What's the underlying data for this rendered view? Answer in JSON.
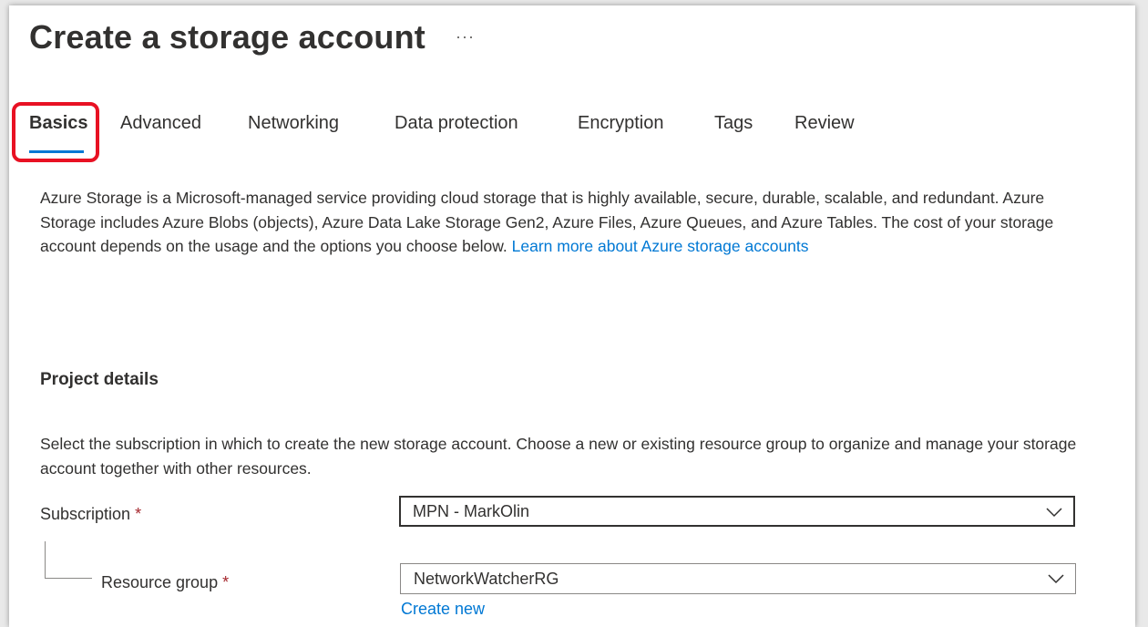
{
  "page": {
    "title": "Create a storage account",
    "more_label": "···"
  },
  "tabs": [
    {
      "label": "Basics",
      "active": true
    },
    {
      "label": "Advanced",
      "active": false
    },
    {
      "label": "Networking",
      "active": false
    },
    {
      "label": "Data protection",
      "active": false
    },
    {
      "label": "Encryption",
      "active": false
    },
    {
      "label": "Tags",
      "active": false
    },
    {
      "label": "Review",
      "active": false
    }
  ],
  "intro": {
    "text": "Azure Storage is a Microsoft-managed service providing cloud storage that is highly available, secure, durable, scalable, and redundant. Azure Storage includes Azure Blobs (objects), Azure Data Lake Storage Gen2, Azure Files, Azure Queues, and Azure Tables. The cost of your storage account depends on the usage and the options you choose below. ",
    "link": "Learn more about Azure storage accounts"
  },
  "project_details": {
    "title": "Project details",
    "description": "Select the subscription in which to create the new storage account. Choose a new or existing resource group to organize and manage your storage account together with other resources.",
    "subscription": {
      "label": "Subscription",
      "required_mark": "*",
      "value": "MPN - MarkOlin"
    },
    "resource_group": {
      "label": "Resource group",
      "required_mark": "*",
      "value": "NetworkWatcherRG",
      "create_new": "Create new"
    }
  },
  "colors": {
    "accent": "#0078d4",
    "highlight": "#e81123",
    "required": "#a4262c"
  },
  "icons": {
    "more": "more-horizontal-icon",
    "dropdown": "chevron-down-icon"
  }
}
